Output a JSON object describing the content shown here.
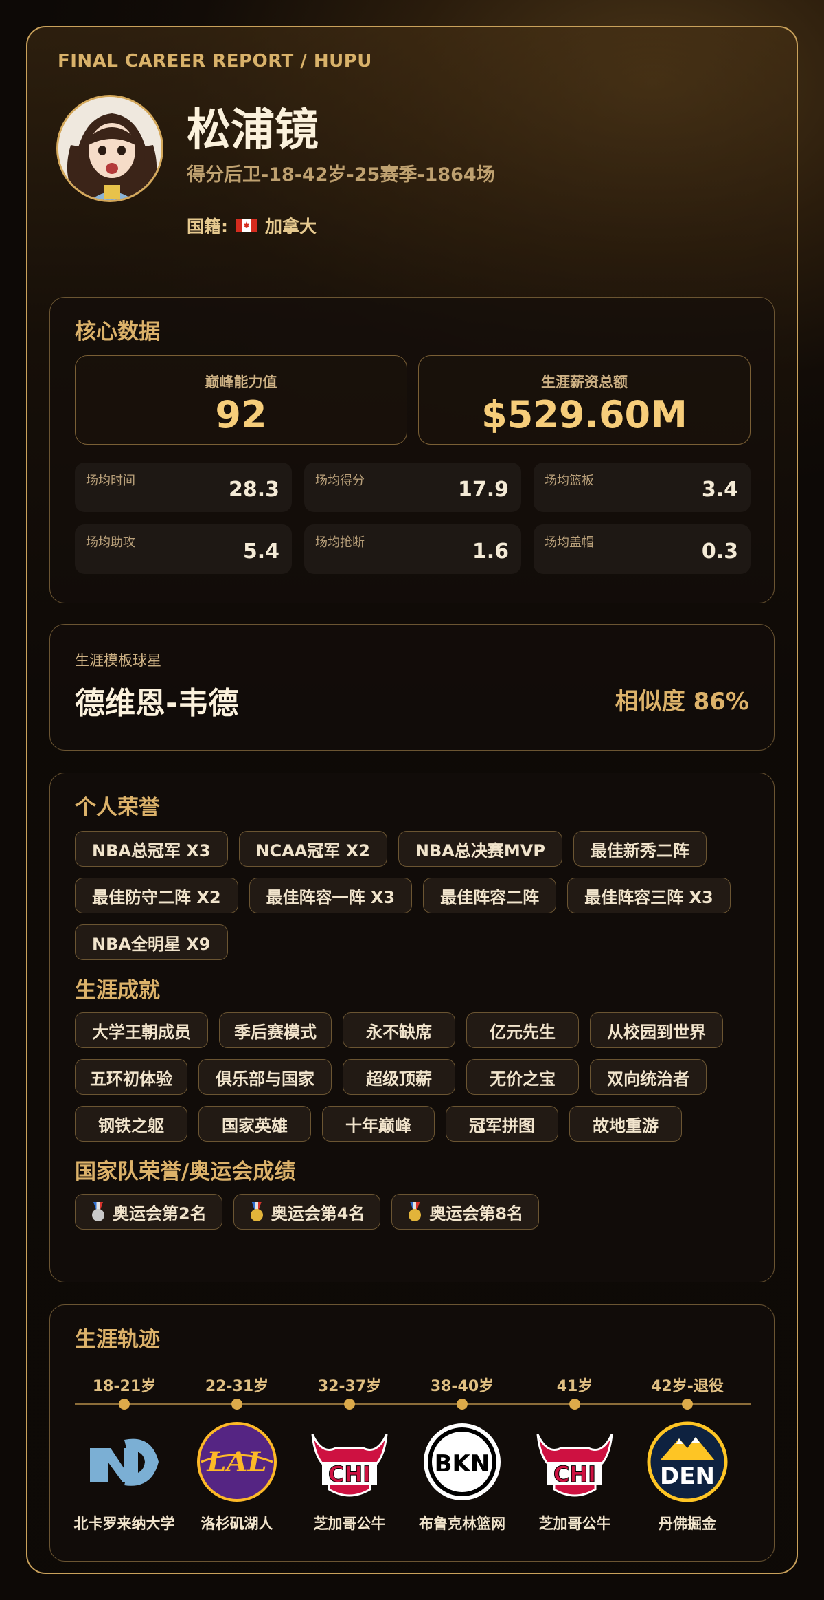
{
  "brand": "FINAL CAREER REPORT / HUPU",
  "player": {
    "name": "松浦镜",
    "subtitle": "得分后卫-18-42岁-25赛季-1864场",
    "nationality_label": "国籍:",
    "nationality": "加拿大",
    "avatar_icon": "avatar-photo"
  },
  "core": {
    "title": "核心数据",
    "peak_label": "巅峰能力值",
    "peak_value": "92",
    "salary_label": "生涯薪资总额",
    "salary_value": "$529.60M",
    "stats": [
      {
        "label": "场均时间",
        "value": "28.3"
      },
      {
        "label": "场均得分",
        "value": "17.9"
      },
      {
        "label": "场均篮板",
        "value": "3.4"
      },
      {
        "label": "场均助攻",
        "value": "5.4"
      },
      {
        "label": "场均抢断",
        "value": "1.6"
      },
      {
        "label": "场均盖帽",
        "value": "0.3"
      }
    ]
  },
  "template": {
    "label": "生涯模板球星",
    "name": "德维恩-韦德",
    "similarity": "相似度 86%"
  },
  "honors": {
    "title": "个人荣誉",
    "items": [
      "NBA总冠军 X3",
      "NCAA冠军 X2",
      "NBA总决赛MVP",
      "最佳新秀二阵",
      "最佳防守二阵 X2",
      "最佳阵容一阵 X3",
      "最佳阵容二阵",
      "最佳阵容三阵 X3",
      "NBA全明星 X9"
    ]
  },
  "achievements": {
    "title": "生涯成就",
    "items": [
      "大学王朝成员",
      "季后赛模式",
      "永不缺席",
      "亿元先生",
      "从校园到世界",
      "五环初体验",
      "俱乐部与国家",
      "超级顶薪",
      "无价之宝",
      "双向统治者",
      "钢铁之躯",
      "国家英雄",
      "十年巅峰",
      "冠军拼图",
      "故地重游"
    ]
  },
  "olympics": {
    "title": "国家队荣誉/奥运会成绩",
    "items": [
      {
        "label": "奥运会第2名",
        "medal": "silver"
      },
      {
        "label": "奥运会第4名",
        "medal": "gold"
      },
      {
        "label": "奥运会第8名",
        "medal": "gold"
      }
    ]
  },
  "career": {
    "title": "生涯轨迹",
    "stops": [
      {
        "age": "18-21岁",
        "team": "北卡罗来纳大学",
        "logo": "unc-logo",
        "logo_text": "NC"
      },
      {
        "age": "22-31岁",
        "team": "洛杉矶湖人",
        "logo": "lakers-logo",
        "logo_text": "LAL"
      },
      {
        "age": "32-37岁",
        "team": "芝加哥公牛",
        "logo": "bulls-logo",
        "logo_text": "CHI"
      },
      {
        "age": "38-40岁",
        "team": "布鲁克林篮网",
        "logo": "nets-logo",
        "logo_text": "BKN"
      },
      {
        "age": "41岁",
        "team": "芝加哥公牛",
        "logo": "bulls-logo",
        "logo_text": "CHI"
      },
      {
        "age": "42岁-退役",
        "team": "丹佛掘金",
        "logo": "nuggets-logo",
        "logo_text": "DEN"
      }
    ]
  },
  "colors": {
    "accent": "#dcb26a",
    "border": "#c9a15b",
    "silver": "#c9c9c9",
    "gold": "#e2b43a"
  }
}
